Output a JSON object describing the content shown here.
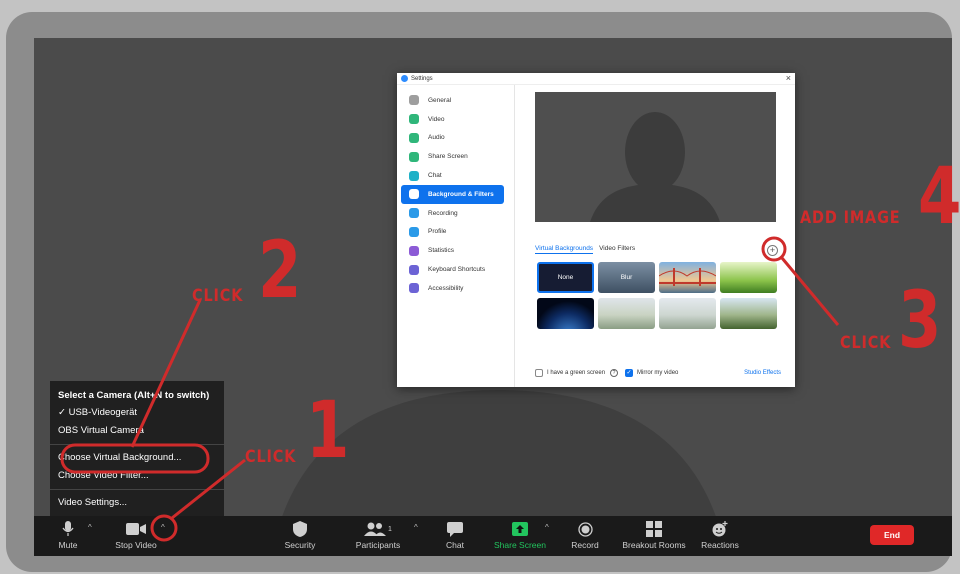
{
  "settings": {
    "title": "Settings",
    "close_symbol": "×",
    "sidebar": [
      {
        "label": "General",
        "icon": "gear-icon",
        "color": "#9e9e9e"
      },
      {
        "label": "Video",
        "icon": "video-icon",
        "color": "#2fb67a"
      },
      {
        "label": "Audio",
        "icon": "headphones-icon",
        "color": "#2fb67a"
      },
      {
        "label": "Share Screen",
        "icon": "share-screen-icon",
        "color": "#2fb67a"
      },
      {
        "label": "Chat",
        "icon": "chat-icon",
        "color": "#1fb1c7"
      },
      {
        "label": "Background & Filters",
        "icon": "background-icon",
        "color": "#0e72ed",
        "active": true
      },
      {
        "label": "Recording",
        "icon": "recording-icon",
        "color": "#2b9ae8"
      },
      {
        "label": "Profile",
        "icon": "profile-icon",
        "color": "#2b9ae8"
      },
      {
        "label": "Statistics",
        "icon": "statistics-icon",
        "color": "#8c5bd6"
      },
      {
        "label": "Keyboard Shortcuts",
        "icon": "keyboard-icon",
        "color": "#6c63d5"
      },
      {
        "label": "Accessibility",
        "icon": "accessibility-icon",
        "color": "#6c63d5"
      }
    ],
    "tabs": {
      "virtual_backgrounds": "Virtual Backgrounds",
      "video_filters": "Video Filters"
    },
    "add_symbol": "+",
    "thumbnails": {
      "none": "None",
      "blur": "Blur"
    },
    "footer": {
      "green_screen": "I have a green screen",
      "help_symbol": "?",
      "mirror": "Mirror my video",
      "check_symbol": "✓",
      "studio_effects": "Studio Effects"
    }
  },
  "camera_menu": {
    "header": "Select a Camera (Alt+N to switch)",
    "cameras": [
      {
        "label": "✓ USB-Videogerät"
      },
      {
        "label": "OBS Virtual Camera"
      }
    ],
    "choose_background": "Choose Virtual Background...",
    "choose_filter": "Choose Video Filter...",
    "video_settings": "Video Settings..."
  },
  "toolbar": {
    "mute": "Mute",
    "stop_video": "Stop Video",
    "security": "Security",
    "participants": "Participants",
    "participants_count": "1",
    "chat": "Chat",
    "share_screen": "Share Screen",
    "record": "Record",
    "breakout_rooms": "Breakout Rooms",
    "reactions": "Reactions",
    "end": "End",
    "caret": "^"
  },
  "callouts": {
    "step1_text": "CLICK",
    "step1_num": "1",
    "step2_text": "CLICK",
    "step2_num": "2",
    "step3_text": "CLICK",
    "step3_num": "3",
    "step4_text": "ADD IMAGE",
    "step4_num": "4",
    "color": "#d02b2b"
  }
}
